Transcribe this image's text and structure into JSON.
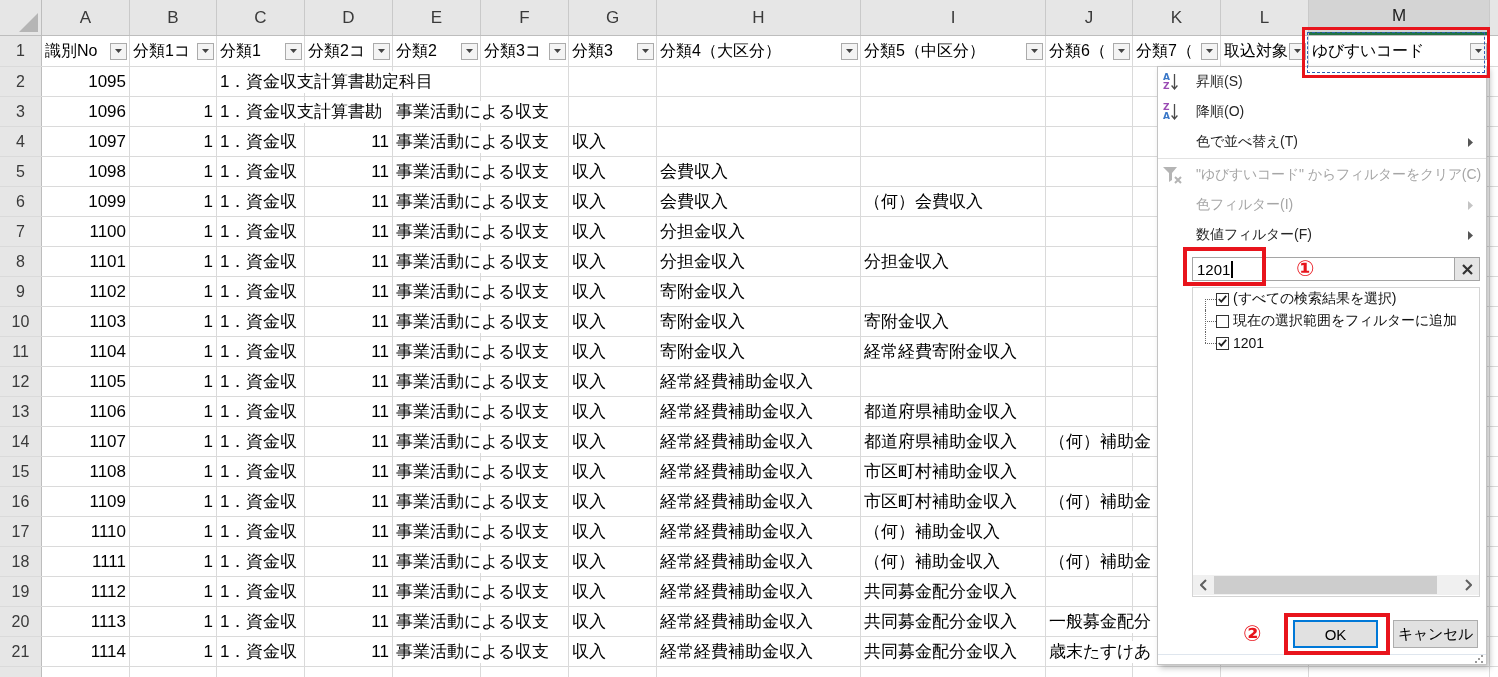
{
  "sheet": {
    "columns": [
      {
        "label": "A",
        "kind": "id",
        "selected": false
      },
      {
        "label": "B",
        "kind": "number",
        "selected": false
      },
      {
        "label": "C",
        "kind": "text",
        "selected": false
      },
      {
        "label": "D",
        "kind": "number",
        "selected": false
      },
      {
        "label": "E",
        "kind": "text",
        "selected": false
      },
      {
        "label": "F",
        "kind": "text",
        "selected": false
      },
      {
        "label": "G",
        "kind": "text",
        "selected": false
      },
      {
        "label": "H",
        "kind": "text",
        "selected": false
      },
      {
        "label": "I",
        "kind": "text",
        "selected": false
      },
      {
        "label": "J",
        "kind": "text",
        "selected": false
      },
      {
        "label": "K",
        "kind": "text",
        "selected": false
      },
      {
        "label": "L",
        "kind": "text",
        "selected": false
      },
      {
        "label": "M",
        "kind": "text",
        "selected": true
      }
    ],
    "header_row": {
      "number": "1",
      "cells": [
        {
          "label": "識別No",
          "filter": true,
          "highlighted": false
        },
        {
          "label": "分類1コ",
          "filter": true,
          "highlighted": false
        },
        {
          "label": "分類1",
          "filter": true,
          "highlighted": false
        },
        {
          "label": "分類2コ",
          "filter": true,
          "highlighted": false
        },
        {
          "label": "分類2",
          "filter": true,
          "highlighted": false
        },
        {
          "label": "分類3コ",
          "filter": true,
          "highlighted": false
        },
        {
          "label": "分類3",
          "filter": true,
          "highlighted": false
        },
        {
          "label": "分類4（大区分）",
          "filter": true,
          "highlighted": false
        },
        {
          "label": "分類5（中区分）",
          "filter": true,
          "highlighted": false
        },
        {
          "label": "分類6（",
          "filter": true,
          "highlighted": false
        },
        {
          "label": "分類7（",
          "filter": true,
          "highlighted": false
        },
        {
          "label": "取込対象",
          "filter": true,
          "highlighted": false
        },
        {
          "label": "ゆびすいコード",
          "filter": true,
          "highlighted": true
        }
      ]
    },
    "rows": [
      {
        "number": "2",
        "cells": {
          "A": "1095",
          "C": "1．資金収支計算書勘定科目"
        }
      },
      {
        "number": "3",
        "cells": {
          "A": "1096",
          "B": "1",
          "C": "1．資金収支計算書勘",
          "E": "事業活動による収支"
        }
      },
      {
        "number": "4",
        "cells": {
          "A": "1097",
          "B": "1",
          "C": "1．資金収",
          "D": "11",
          "E": "事業活動による収支",
          "G": "収入"
        }
      },
      {
        "number": "5",
        "cells": {
          "A": "1098",
          "B": "1",
          "C": "1．資金収",
          "D": "11",
          "E": "事業活動による収支",
          "G": "収入",
          "H": "会費収入"
        }
      },
      {
        "number": "6",
        "cells": {
          "A": "1099",
          "B": "1",
          "C": "1．資金収",
          "D": "11",
          "E": "事業活動による収支",
          "G": "収入",
          "H": "会費収入",
          "I": "（何）会費収入"
        }
      },
      {
        "number": "7",
        "cells": {
          "A": "1100",
          "B": "1",
          "C": "1．資金収",
          "D": "11",
          "E": "事業活動による収支",
          "G": "収入",
          "H": "分担金収入"
        }
      },
      {
        "number": "8",
        "cells": {
          "A": "1101",
          "B": "1",
          "C": "1．資金収",
          "D": "11",
          "E": "事業活動による収支",
          "G": "収入",
          "H": "分担金収入",
          "I": "分担金収入"
        }
      },
      {
        "number": "9",
        "cells": {
          "A": "1102",
          "B": "1",
          "C": "1．資金収",
          "D": "11",
          "E": "事業活動による収支",
          "G": "収入",
          "H": "寄附金収入"
        }
      },
      {
        "number": "10",
        "cells": {
          "A": "1103",
          "B": "1",
          "C": "1．資金収",
          "D": "11",
          "E": "事業活動による収支",
          "G": "収入",
          "H": "寄附金収入",
          "I": "寄附金収入"
        }
      },
      {
        "number": "11",
        "cells": {
          "A": "1104",
          "B": "1",
          "C": "1．資金収",
          "D": "11",
          "E": "事業活動による収支",
          "G": "収入",
          "H": "寄附金収入",
          "I": "経常経費寄附金収入"
        }
      },
      {
        "number": "12",
        "cells": {
          "A": "1105",
          "B": "1",
          "C": "1．資金収",
          "D": "11",
          "E": "事業活動による収支",
          "G": "収入",
          "H": "経常経費補助金収入"
        }
      },
      {
        "number": "13",
        "cells": {
          "A": "1106",
          "B": "1",
          "C": "1．資金収",
          "D": "11",
          "E": "事業活動による収支",
          "G": "収入",
          "H": "経常経費補助金収入",
          "I": "都道府県補助金収入"
        }
      },
      {
        "number": "14",
        "cells": {
          "A": "1107",
          "B": "1",
          "C": "1．資金収",
          "D": "11",
          "E": "事業活動による収支",
          "G": "収入",
          "H": "経常経費補助金収入",
          "I": "都道府県補助金収入",
          "J": "（何）補助金"
        }
      },
      {
        "number": "15",
        "cells": {
          "A": "1108",
          "B": "1",
          "C": "1．資金収",
          "D": "11",
          "E": "事業活動による収支",
          "G": "収入",
          "H": "経常経費補助金収入",
          "I": "市区町村補助金収入"
        }
      },
      {
        "number": "16",
        "cells": {
          "A": "1109",
          "B": "1",
          "C": "1．資金収",
          "D": "11",
          "E": "事業活動による収支",
          "G": "収入",
          "H": "経常経費補助金収入",
          "I": "市区町村補助金収入",
          "J": "（何）補助金"
        }
      },
      {
        "number": "17",
        "cells": {
          "A": "1110",
          "B": "1",
          "C": "1．資金収",
          "D": "11",
          "E": "事業活動による収支",
          "G": "収入",
          "H": "経常経費補助金収入",
          "I": "（何）補助金収入"
        }
      },
      {
        "number": "18",
        "cells": {
          "A": "1111",
          "B": "1",
          "C": "1．資金収",
          "D": "11",
          "E": "事業活動による収支",
          "G": "収入",
          "H": "経常経費補助金収入",
          "I": "（何）補助金収入",
          "J": "（何）補助金"
        }
      },
      {
        "number": "19",
        "cells": {
          "A": "1112",
          "B": "1",
          "C": "1．資金収",
          "D": "11",
          "E": "事業活動による収支",
          "G": "収入",
          "H": "経常経費補助金収入",
          "I": "共同募金配分金収入"
        }
      },
      {
        "number": "20",
        "cells": {
          "A": "1113",
          "B": "1",
          "C": "1．資金収",
          "D": "11",
          "E": "事業活動による収支",
          "G": "収入",
          "H": "経常経費補助金収入",
          "I": "共同募金配分金収入",
          "J": "一般募金配分"
        }
      },
      {
        "number": "21",
        "cells": {
          "A": "1114",
          "B": "1",
          "C": "1．資金収",
          "D": "11",
          "E": "事業活動による収支",
          "G": "収入",
          "H": "経常経費補助金収入",
          "I": "共同募金配分金収入",
          "J": "歳末たすけあ"
        }
      }
    ]
  },
  "filter_menu": {
    "items": [
      {
        "kind": "sort",
        "label": "昇順(S)",
        "icon_glyphs": [
          {
            "text": "A",
            "color": "#3a78c8"
          },
          {
            "text": "Z",
            "color": "#9a4bb4"
          }
        ],
        "disabled": false,
        "submenu": false
      },
      {
        "kind": "sort",
        "label": "降順(O)",
        "icon_glyphs": [
          {
            "text": "Z",
            "color": "#9a4bb4"
          },
          {
            "text": "A",
            "color": "#3a78c8"
          }
        ],
        "disabled": false,
        "submenu": false
      },
      {
        "kind": "command",
        "label": "色で並べ替え(T)",
        "disabled": false,
        "submenu": true
      },
      {
        "kind": "separator"
      },
      {
        "kind": "clear",
        "label": "\"ゆびすいコード\" からフィルターをクリア(C)",
        "disabled": true,
        "submenu": false
      },
      {
        "kind": "command",
        "label": "色フィルター(I)",
        "disabled": true,
        "submenu": true
      },
      {
        "kind": "command",
        "label": "数値フィルター(F)",
        "disabled": false,
        "submenu": true
      }
    ],
    "search": {
      "value": "1201",
      "focused": true,
      "highlighted": true,
      "step_marker": "①"
    },
    "list": [
      {
        "label": "(すべての検索結果を選択)",
        "checked": true
      },
      {
        "label": "現在の選択範囲をフィルターに追加",
        "checked": false
      },
      {
        "label": "1201",
        "checked": true
      }
    ],
    "buttons": [
      {
        "label": "OK",
        "kind": "primary",
        "highlighted": true,
        "step_marker": "②"
      },
      {
        "label": "キャンセル",
        "kind": "secondary",
        "highlighted": false
      }
    ]
  }
}
